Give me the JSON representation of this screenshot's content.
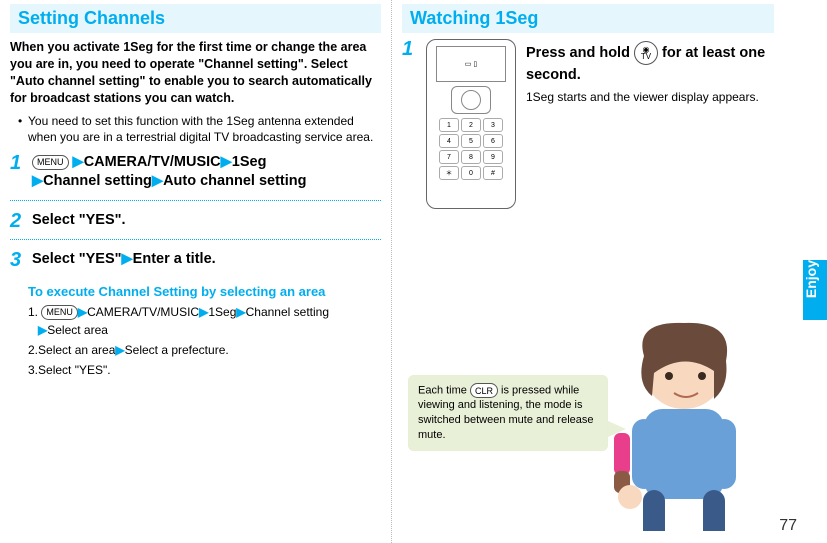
{
  "side_tab": "Enjoy",
  "page_number": "77",
  "icons": {
    "menu": "MENU",
    "clr": "CLR",
    "tv": "TV",
    "cam_glyph": "◉"
  },
  "left": {
    "heading": "Setting Channels",
    "intro": "When you activate 1Seg for the first time or change the area you are in, you need to operate \"Channel setting\". Select \"Auto channel setting\" to enable you to search automatically for broadcast stations you can watch.",
    "bullet": "You need to set this function with the 1Seg antenna extended when you are in a terrestrial digital TV broadcasting service area.",
    "step1": {
      "num": "1",
      "parts": {
        "p1": "CAMERA/TV/MUSIC",
        "p2": "1Seg",
        "p3": "Channel setting",
        "p4": "Auto channel setting"
      }
    },
    "step2": {
      "num": "2",
      "text": "Select \"YES\"."
    },
    "step3": {
      "num": "3",
      "a": "Select \"YES\"",
      "b": "Enter a title."
    },
    "sub_head": "To execute Channel Setting by selecting an area",
    "sub": {
      "l1": {
        "n": "1.",
        "a": "CAMERA/TV/MUSIC",
        "b": "1Seg",
        "c": "Channel setting",
        "d": "Select area"
      },
      "l2": {
        "n": "2.",
        "a": "Select an area",
        "b": "Select a prefecture."
      },
      "l3": {
        "n": "3.",
        "a": "Select \"YES\"."
      }
    }
  },
  "right": {
    "heading": "Watching 1Seg",
    "step1": {
      "num": "1",
      "title_a": "Press and hold ",
      "title_b": " for at least one second.",
      "desc": "1Seg starts and the viewer display appears."
    },
    "tip": {
      "a": "Each time ",
      "b": " is pressed while viewing and listening, the mode is switched between mute and release mute."
    },
    "keys": [
      "1",
      "2",
      "3",
      "4",
      "5",
      "6",
      "7",
      "8",
      "9",
      "＊",
      "0",
      "#"
    ]
  }
}
